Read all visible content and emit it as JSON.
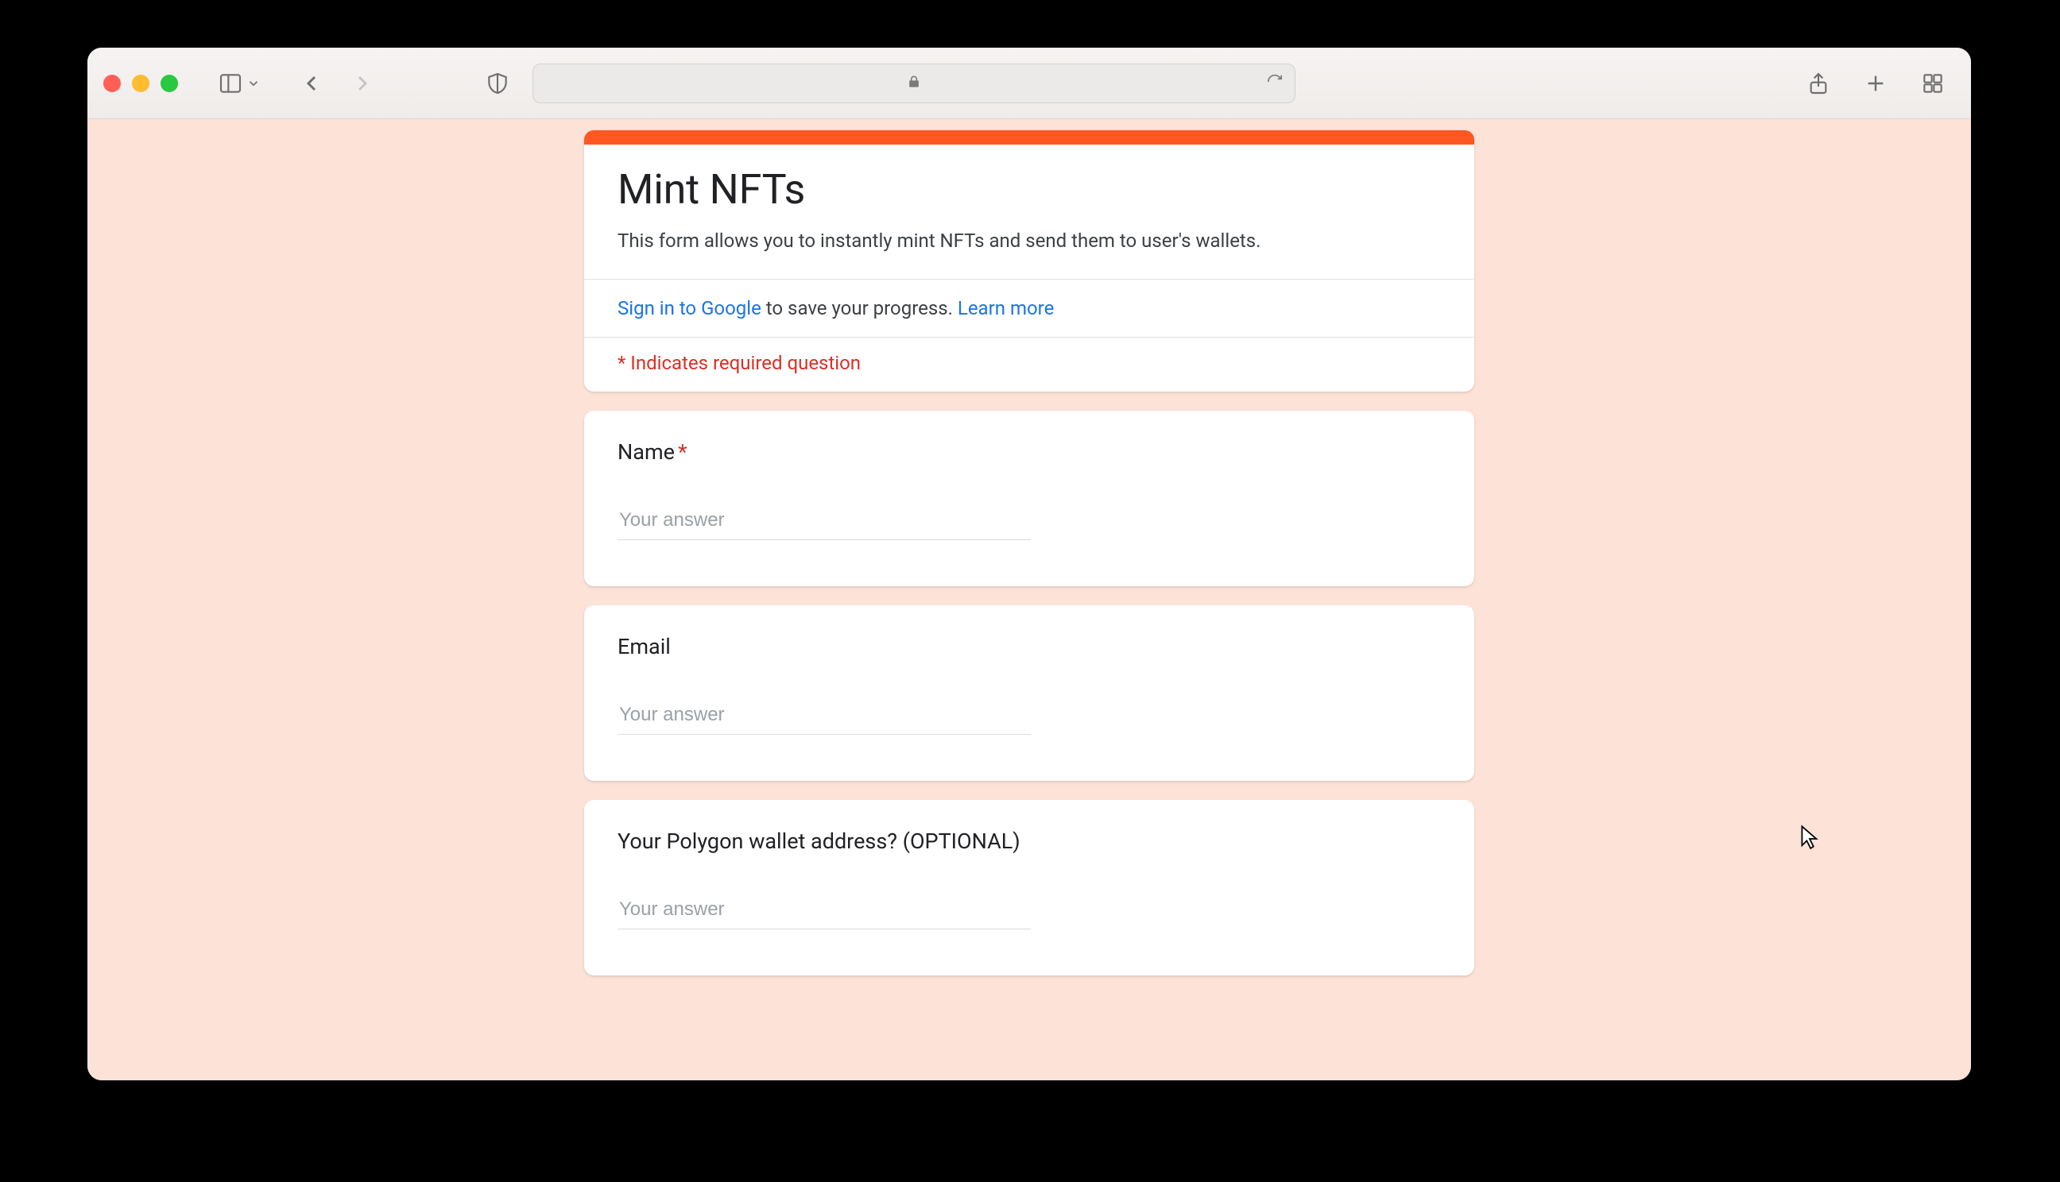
{
  "colors": {
    "page_bg": "#fde2d8",
    "accent": "#ff5722",
    "link": "#1a73e8",
    "required": "#d93025"
  },
  "header": {
    "title": "Mint NFTs",
    "description": "This form allows you to instantly mint NFTs and send them to user's wallets."
  },
  "signin": {
    "link_text": "Sign in to Google",
    "suffix": " to save your progress. ",
    "learn_more": "Learn more"
  },
  "required_notice": "* Indicates required question",
  "questions": [
    {
      "label": "Name",
      "required": true,
      "placeholder": "Your answer",
      "value": ""
    },
    {
      "label": "Email",
      "required": false,
      "placeholder": "Your answer",
      "value": ""
    },
    {
      "label": "Your Polygon wallet address? (OPTIONAL)",
      "required": false,
      "placeholder": "Your answer",
      "value": ""
    }
  ],
  "chrome": {
    "traffic": {
      "close": "close",
      "minimize": "minimize",
      "zoom": "zoom"
    },
    "icons": {
      "sidebar": "sidebar-icon",
      "dropdown": "chevron-down-icon",
      "back": "chevron-left-icon",
      "forward": "chevron-right-icon",
      "shield": "shield-icon",
      "lock": "lock-icon",
      "refresh": "refresh-icon",
      "share": "share-icon",
      "new_tab": "plus-icon",
      "tabs": "grid-icon"
    },
    "url_value": ""
  }
}
